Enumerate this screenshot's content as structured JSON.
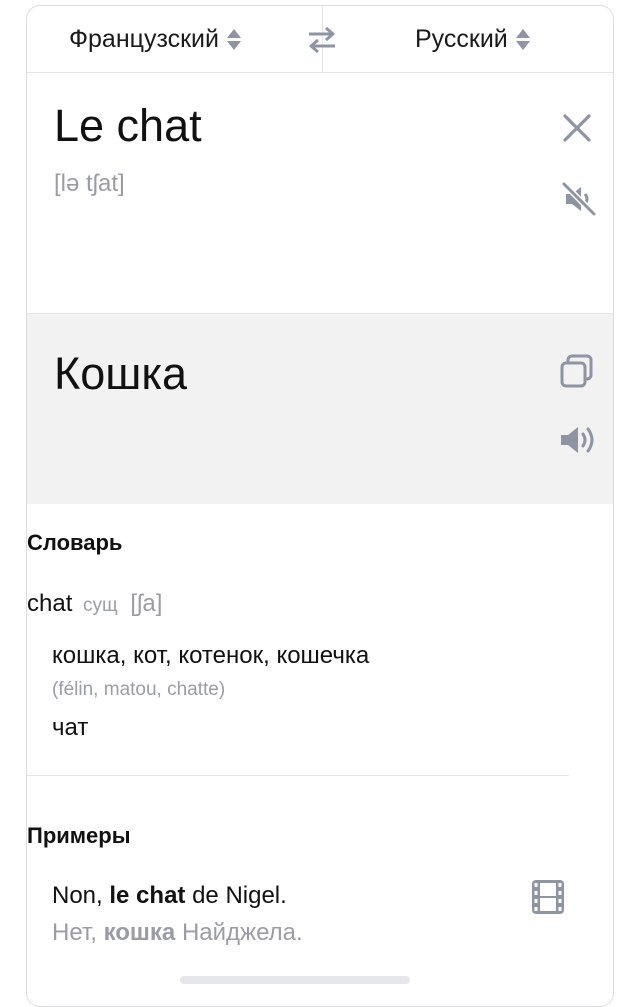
{
  "languages": {
    "source": "Французский",
    "target": "Русский"
  },
  "source": {
    "text": "Le chat",
    "transliteration": "[lə tʃat]"
  },
  "translation": {
    "text": "Кошка"
  },
  "dictionary": {
    "title": "Словарь",
    "entry": {
      "word": "chat",
      "pos": "сущ",
      "ipa": "[ʃa]",
      "sense1": "кошка, кот, котенок, кошечка",
      "sense1_note": "(félin, matou, chatte)",
      "sense2": "чат"
    }
  },
  "examples": {
    "title": "Примеры",
    "items": [
      {
        "src_pre": "Non, ",
        "src_bold": "le chat",
        "src_post": " de Nigel.",
        "tr_pre": "Нет, ",
        "tr_bold": "кошка",
        "tr_post": " Найджела."
      }
    ]
  },
  "icons": {
    "sort": "sort-arrows-icon",
    "swap": "swap-languages-icon",
    "close": "close-icon",
    "mute": "speaker-muted-icon",
    "copy": "copy-icon",
    "speak": "speaker-icon",
    "video": "film-icon"
  },
  "colors": {
    "icon_gray": "#8f94a3",
    "muted_text": "#9a9ca6",
    "translation_bg": "#f2f2f3"
  }
}
